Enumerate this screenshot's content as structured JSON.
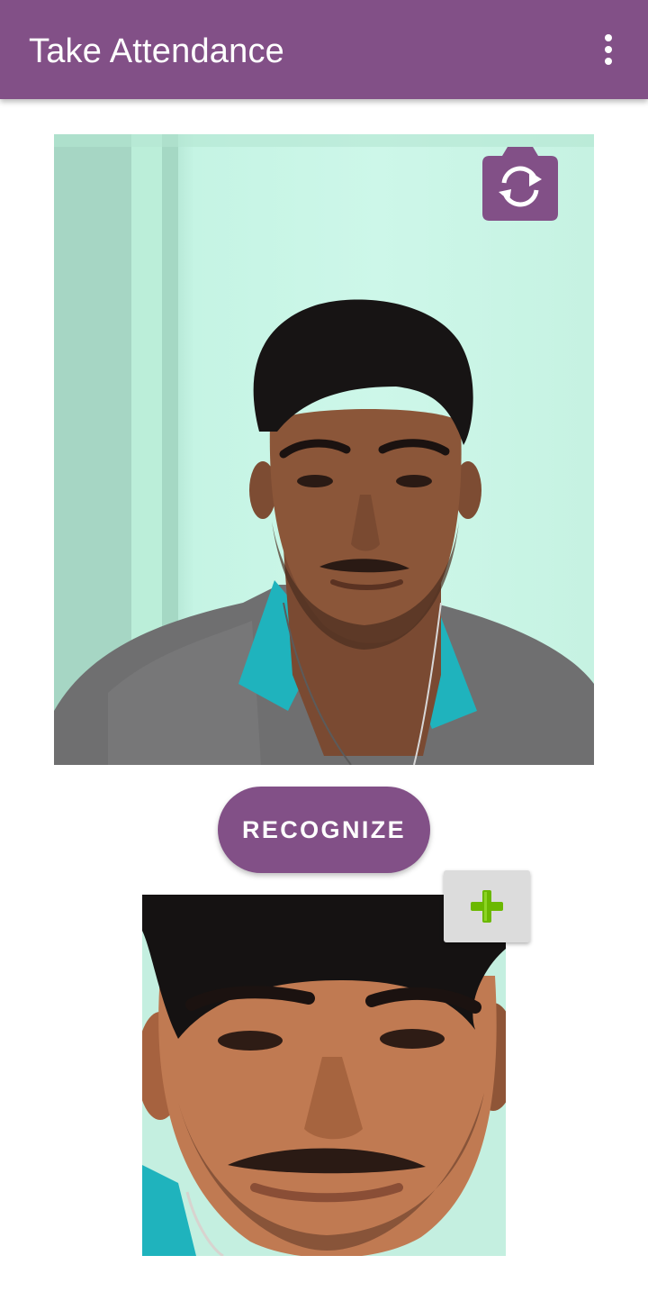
{
  "app_bar": {
    "title": "Take Attendance",
    "background_color": "#825087",
    "overflow_icon": "more-vert-icon"
  },
  "camera_preview": {
    "switch_camera_icon": "switch-camera-icon"
  },
  "recognize_button": {
    "label": "RECOGNIZE",
    "color": "#825087"
  },
  "detected_face": {
    "add_icon": "add-plus-icon",
    "add_icon_color": "#6bb800"
  }
}
